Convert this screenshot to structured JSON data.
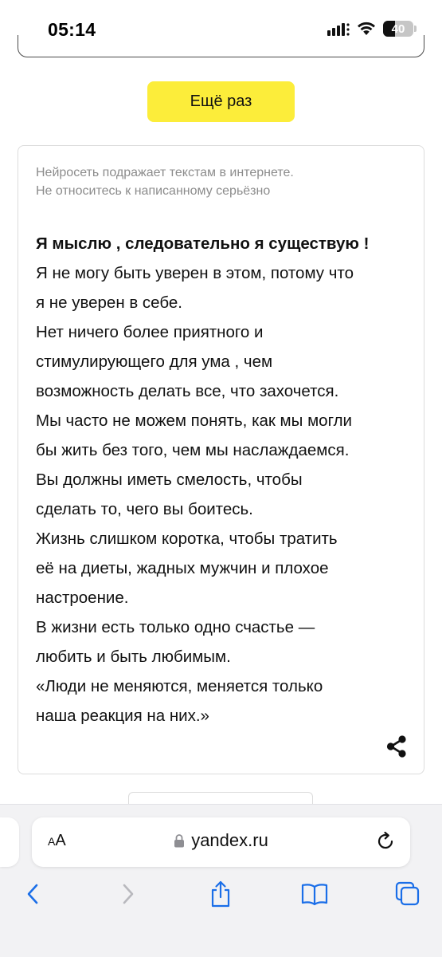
{
  "status_bar": {
    "time": "05:14",
    "battery_level": "40",
    "battery_fraction": 0.4,
    "icons": [
      "cellular-signal-icon",
      "wifi-icon",
      "battery-icon"
    ]
  },
  "page": {
    "again_button_label": "Ещё раз",
    "accent_color": "#fced3a",
    "disclaimer_lines": [
      "Нейросеть подражает текстам в интернете.",
      "Не относитесь к написанному серьёзно"
    ],
    "result_title": "Я мыслю , следовательно я существую !",
    "result_lines": [
      "Я не могу быть уверен в этом, потому что",
      "я не уверен в себе.",
      "Нет ничего более приятного и",
      "стимулирующего для ума , чем",
      "возможность делать все, что захочется.",
      "Мы часто не можем понять, как мы могли",
      "бы жить без того, чем мы наслаждаемся.",
      "Вы должны иметь смелость, чтобы",
      "сделать то, чего вы боитесь.",
      "Жизнь слишком коротка, чтобы тратить",
      "её на диеты, жадных мужчин и плохое",
      "настроение.",
      "В жизни есть только одно счастье —",
      "любить и быть любимым.",
      "«Люди не меняются, меняется только",
      "наша реакция на них.»"
    ],
    "share_icon": "share-icon"
  },
  "browser": {
    "aa_small": "A",
    "aa_large": "A",
    "url": "yandex.ru",
    "accent_color": "#1a6ee8",
    "disabled_color": "#b8b8bd"
  }
}
